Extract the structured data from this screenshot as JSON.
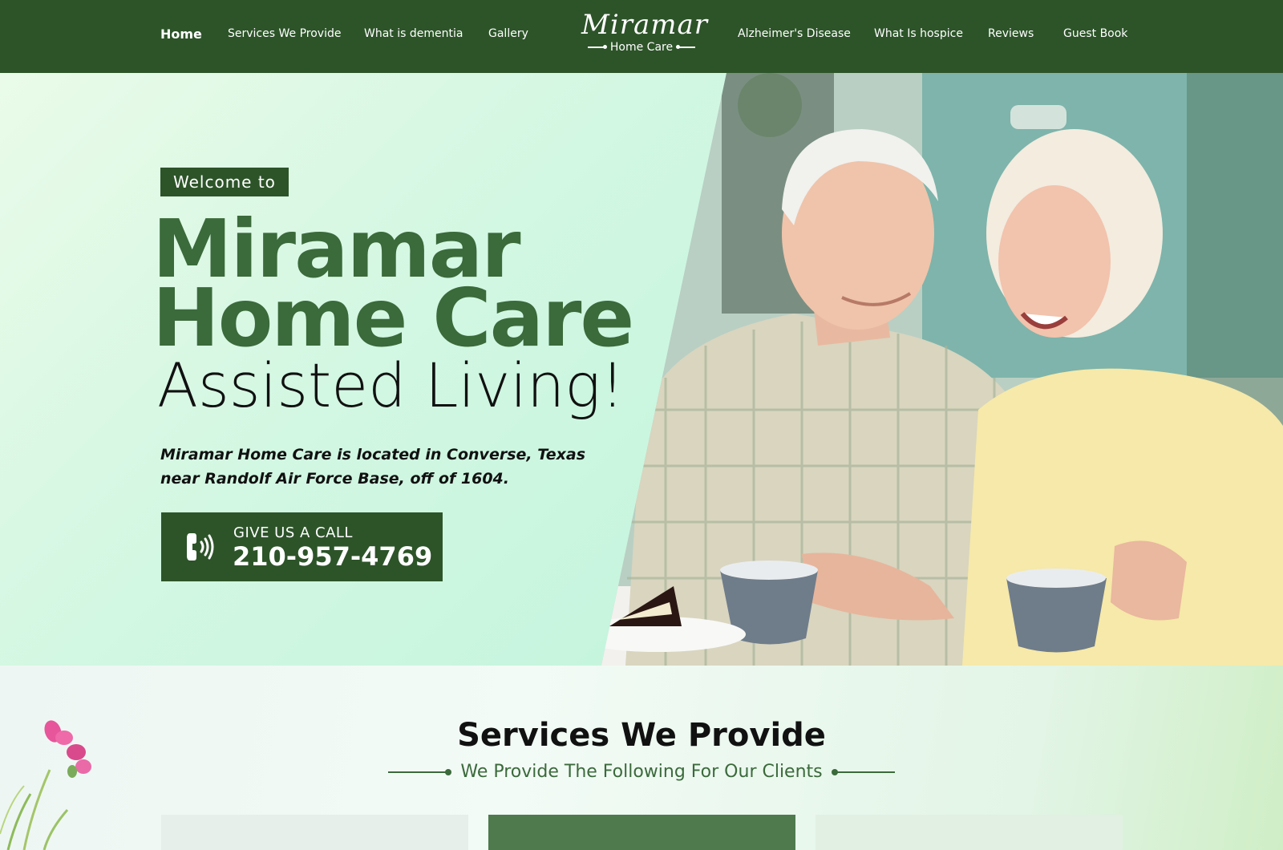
{
  "nav": {
    "left_items": [
      {
        "label": "Home",
        "active": true
      },
      {
        "label": "Services We Provide"
      },
      {
        "label": "What is dementia"
      },
      {
        "label": "Gallery"
      }
    ],
    "right_items": [
      {
        "label": "Alzheimer's Disease"
      },
      {
        "label": "What Is hospice"
      },
      {
        "label": "Reviews"
      },
      {
        "label": "Guest Book"
      }
    ],
    "logo": {
      "name": "Miramar",
      "sub": "Home Care"
    }
  },
  "hero": {
    "welcome": "Welcome to",
    "title_line1": "Miramar",
    "title_line2": "Home Care",
    "title_line3": "Assisted Living!",
    "description": "Miramar Home Care is located in Converse, Texas near Randolf Air Force Base, off of 1604.",
    "call": {
      "label": "GIVE US A CALL",
      "number": "210-957-4769",
      "icon": "phone-icon"
    },
    "image": {
      "icon": "photo-elderly-couple"
    }
  },
  "services": {
    "title": "Services We Provide",
    "subtitle": "We Provide The Following For Our Clients"
  },
  "colors": {
    "brand_dark": "#2d5429",
    "brand_green": "#3b6a3b",
    "hero_bg": "#c8f4df",
    "white": "#ffffff"
  }
}
